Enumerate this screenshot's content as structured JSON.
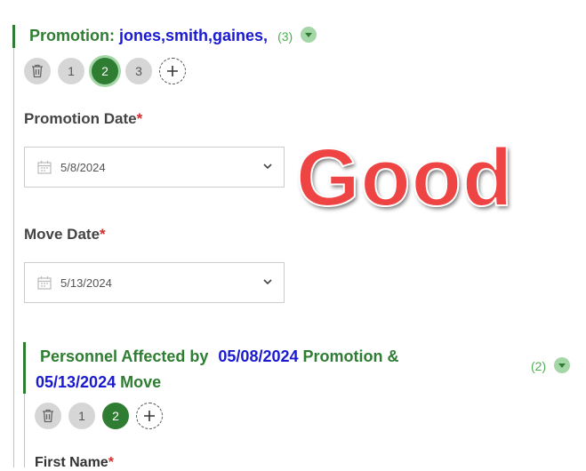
{
  "promotion": {
    "label": "Promotion:",
    "names": "jones,smith,gaines,",
    "count": "(3)",
    "pages": [
      "1",
      "2",
      "3"
    ],
    "active_page": "2"
  },
  "promotion_date": {
    "label": "Promotion Date",
    "required_mark": "*",
    "value": "5/8/2024"
  },
  "move_date": {
    "label": "Move Date",
    "required_mark": "*",
    "value": "5/13/2024"
  },
  "overlay_text": "Good",
  "personnel": {
    "prefix": "Personnel Affected by",
    "date1": "05/08/2024",
    "middle": "Promotion &",
    "date2": "05/13/2024",
    "suffix": "Move",
    "count": "(2)",
    "pages": [
      "1",
      "2"
    ],
    "active_page": "2"
  },
  "first_name": {
    "label": "First Name",
    "required_mark": "*"
  },
  "colors": {
    "primary_green": "#2e7d32",
    "light_green": "#a5d6a7",
    "link_blue": "#1a1ad0",
    "required_red": "#d32f2f",
    "overlay_red": "#ef4444"
  },
  "icons": [
    "trash-icon",
    "plus-icon",
    "calendar-icon",
    "chevron-down-icon",
    "dropdown-arrow-icon"
  ]
}
